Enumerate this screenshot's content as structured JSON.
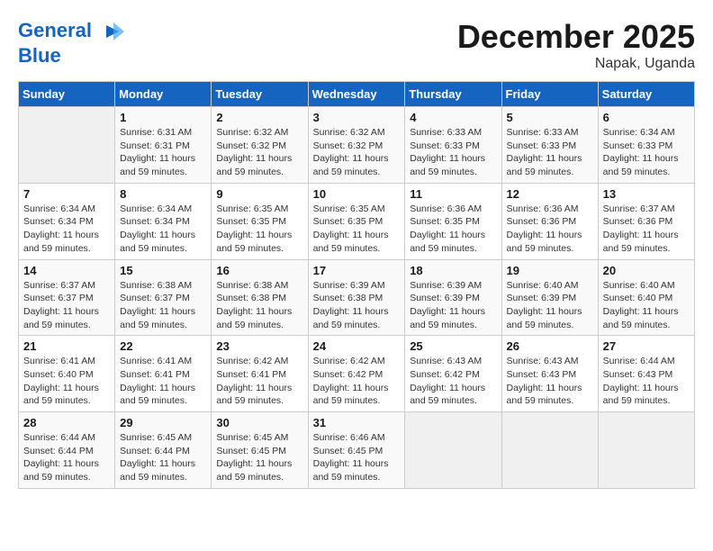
{
  "header": {
    "logo_line1": "General",
    "logo_line2": "Blue",
    "month": "December 2025",
    "location": "Napak, Uganda"
  },
  "days_of_week": [
    "Sunday",
    "Monday",
    "Tuesday",
    "Wednesday",
    "Thursday",
    "Friday",
    "Saturday"
  ],
  "weeks": [
    [
      {
        "day": "",
        "empty": true
      },
      {
        "day": "1",
        "sunrise": "6:31 AM",
        "sunset": "6:31 PM",
        "daylight": "11 hours and 59 minutes."
      },
      {
        "day": "2",
        "sunrise": "6:32 AM",
        "sunset": "6:32 PM",
        "daylight": "11 hours and 59 minutes."
      },
      {
        "day": "3",
        "sunrise": "6:32 AM",
        "sunset": "6:32 PM",
        "daylight": "11 hours and 59 minutes."
      },
      {
        "day": "4",
        "sunrise": "6:33 AM",
        "sunset": "6:33 PM",
        "daylight": "11 hours and 59 minutes."
      },
      {
        "day": "5",
        "sunrise": "6:33 AM",
        "sunset": "6:33 PM",
        "daylight": "11 hours and 59 minutes."
      },
      {
        "day": "6",
        "sunrise": "6:34 AM",
        "sunset": "6:33 PM",
        "daylight": "11 hours and 59 minutes."
      }
    ],
    [
      {
        "day": "7",
        "sunrise": "6:34 AM",
        "sunset": "6:34 PM",
        "daylight": "11 hours and 59 minutes."
      },
      {
        "day": "8",
        "sunrise": "6:34 AM",
        "sunset": "6:34 PM",
        "daylight": "11 hours and 59 minutes."
      },
      {
        "day": "9",
        "sunrise": "6:35 AM",
        "sunset": "6:35 PM",
        "daylight": "11 hours and 59 minutes."
      },
      {
        "day": "10",
        "sunrise": "6:35 AM",
        "sunset": "6:35 PM",
        "daylight": "11 hours and 59 minutes."
      },
      {
        "day": "11",
        "sunrise": "6:36 AM",
        "sunset": "6:35 PM",
        "daylight": "11 hours and 59 minutes."
      },
      {
        "day": "12",
        "sunrise": "6:36 AM",
        "sunset": "6:36 PM",
        "daylight": "11 hours and 59 minutes."
      },
      {
        "day": "13",
        "sunrise": "6:37 AM",
        "sunset": "6:36 PM",
        "daylight": "11 hours and 59 minutes."
      }
    ],
    [
      {
        "day": "14",
        "sunrise": "6:37 AM",
        "sunset": "6:37 PM",
        "daylight": "11 hours and 59 minutes."
      },
      {
        "day": "15",
        "sunrise": "6:38 AM",
        "sunset": "6:37 PM",
        "daylight": "11 hours and 59 minutes."
      },
      {
        "day": "16",
        "sunrise": "6:38 AM",
        "sunset": "6:38 PM",
        "daylight": "11 hours and 59 minutes."
      },
      {
        "day": "17",
        "sunrise": "6:39 AM",
        "sunset": "6:38 PM",
        "daylight": "11 hours and 59 minutes."
      },
      {
        "day": "18",
        "sunrise": "6:39 AM",
        "sunset": "6:39 PM",
        "daylight": "11 hours and 59 minutes."
      },
      {
        "day": "19",
        "sunrise": "6:40 AM",
        "sunset": "6:39 PM",
        "daylight": "11 hours and 59 minutes."
      },
      {
        "day": "20",
        "sunrise": "6:40 AM",
        "sunset": "6:40 PM",
        "daylight": "11 hours and 59 minutes."
      }
    ],
    [
      {
        "day": "21",
        "sunrise": "6:41 AM",
        "sunset": "6:40 PM",
        "daylight": "11 hours and 59 minutes."
      },
      {
        "day": "22",
        "sunrise": "6:41 AM",
        "sunset": "6:41 PM",
        "daylight": "11 hours and 59 minutes."
      },
      {
        "day": "23",
        "sunrise": "6:42 AM",
        "sunset": "6:41 PM",
        "daylight": "11 hours and 59 minutes."
      },
      {
        "day": "24",
        "sunrise": "6:42 AM",
        "sunset": "6:42 PM",
        "daylight": "11 hours and 59 minutes."
      },
      {
        "day": "25",
        "sunrise": "6:43 AM",
        "sunset": "6:42 PM",
        "daylight": "11 hours and 59 minutes."
      },
      {
        "day": "26",
        "sunrise": "6:43 AM",
        "sunset": "6:43 PM",
        "daylight": "11 hours and 59 minutes."
      },
      {
        "day": "27",
        "sunrise": "6:44 AM",
        "sunset": "6:43 PM",
        "daylight": "11 hours and 59 minutes."
      }
    ],
    [
      {
        "day": "28",
        "sunrise": "6:44 AM",
        "sunset": "6:44 PM",
        "daylight": "11 hours and 59 minutes."
      },
      {
        "day": "29",
        "sunrise": "6:45 AM",
        "sunset": "6:44 PM",
        "daylight": "11 hours and 59 minutes."
      },
      {
        "day": "30",
        "sunrise": "6:45 AM",
        "sunset": "6:45 PM",
        "daylight": "11 hours and 59 minutes."
      },
      {
        "day": "31",
        "sunrise": "6:46 AM",
        "sunset": "6:45 PM",
        "daylight": "11 hours and 59 minutes."
      },
      {
        "day": "",
        "empty": true
      },
      {
        "day": "",
        "empty": true
      },
      {
        "day": "",
        "empty": true
      }
    ]
  ]
}
